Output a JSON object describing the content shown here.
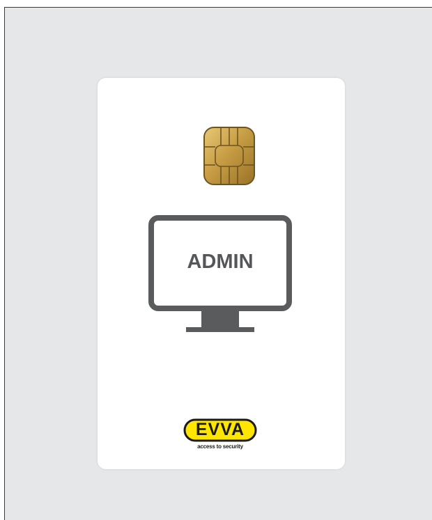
{
  "card": {
    "label": "ADMIN",
    "logo": {
      "wordmark": "EVVA",
      "tagline": "access to security",
      "color": "#ffe600"
    }
  },
  "colors": {
    "background": "#e6e7e8",
    "card": "#ffffff",
    "monitor": "#5a5b5d",
    "chip_gold": "#c8a24a"
  },
  "icons": {
    "chip": "smart-card-chip-icon",
    "monitor": "computer-monitor-icon"
  }
}
